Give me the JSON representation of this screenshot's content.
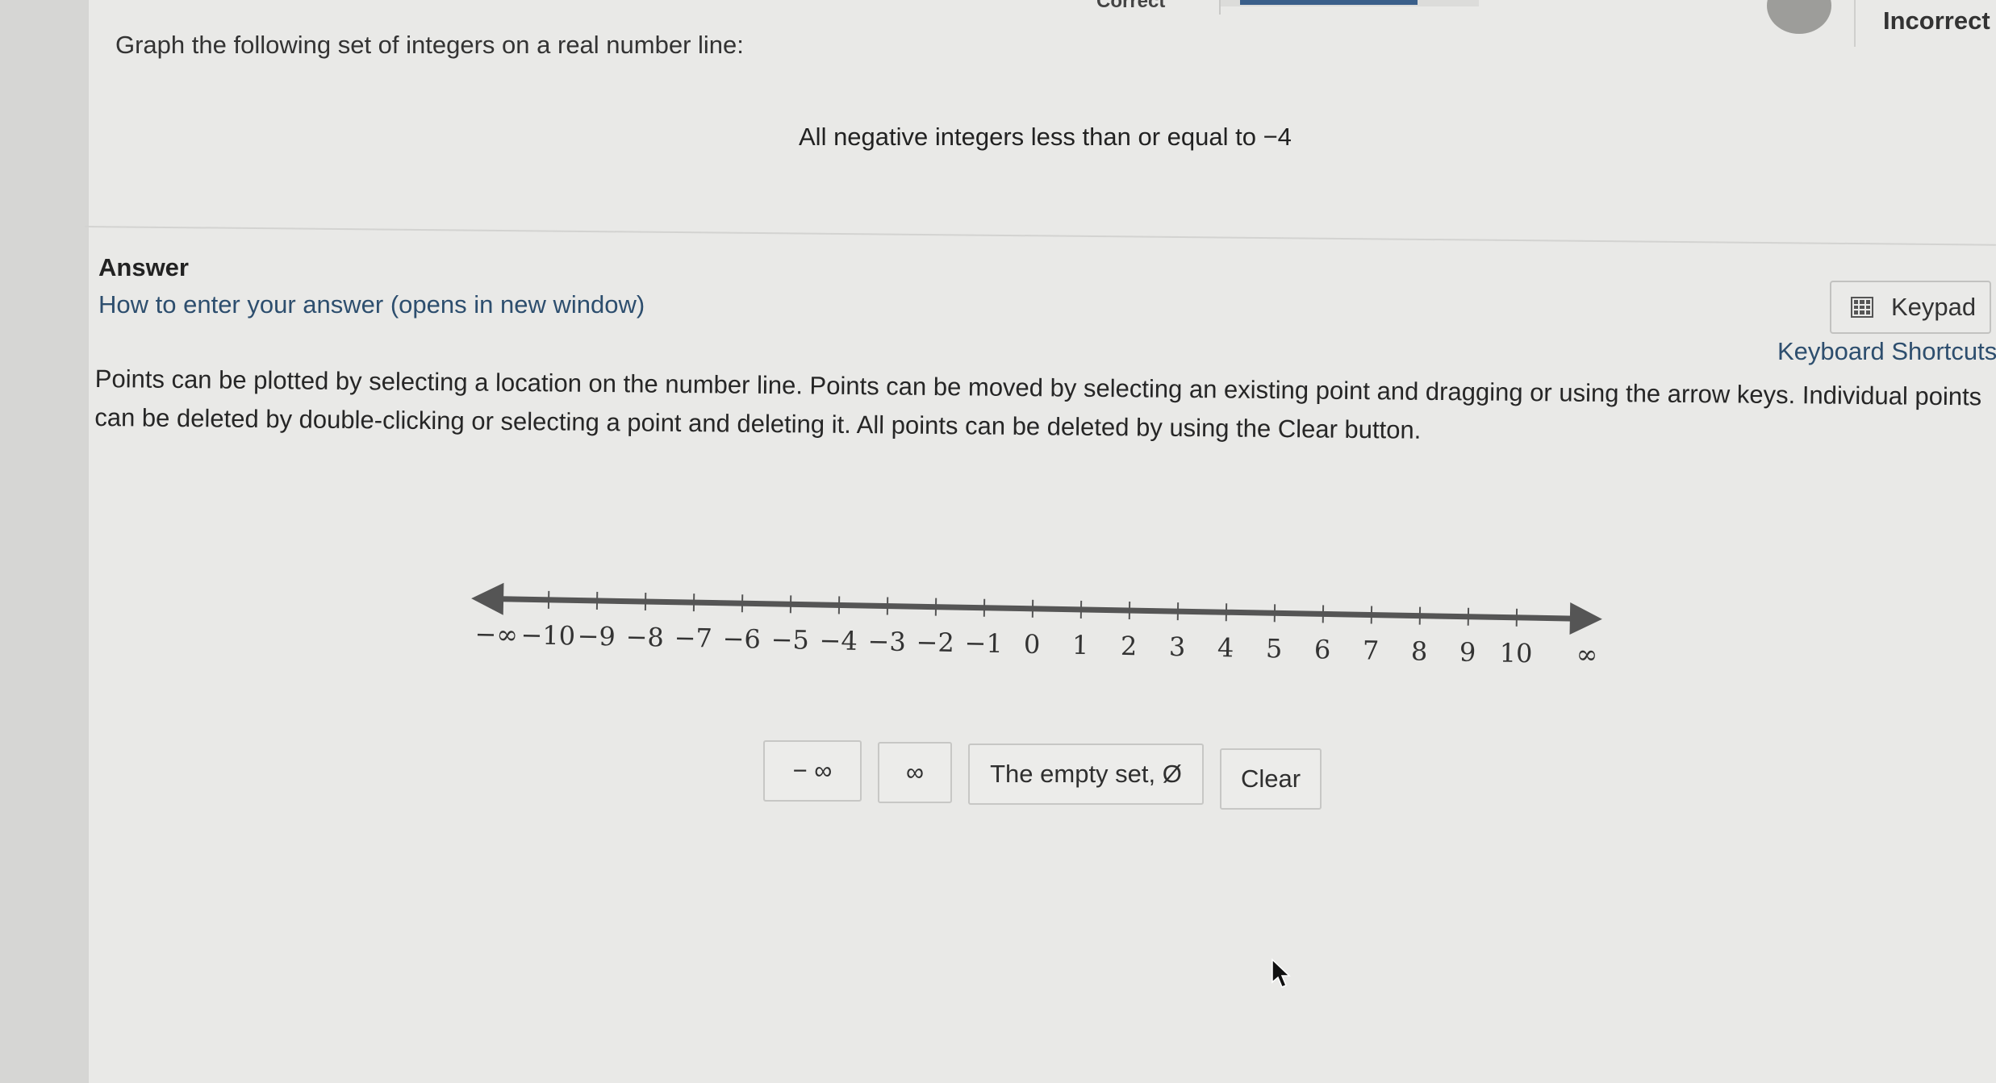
{
  "header": {
    "correct_tab_label": "Correct",
    "status_label": "Incorrect"
  },
  "question": {
    "prompt": "Graph the following set of integers on a real number line:",
    "statement": "All negative integers less than or equal to −4"
  },
  "answer": {
    "title": "Answer",
    "howto_link": "How to enter your answer (opens in new window)",
    "keypad_label": "Keypad",
    "keypad_icon": "calculator-icon",
    "shortcuts_link": "Keyboard Shortcuts",
    "instructions": "Points can be plotted by selecting a location on the number line. Points can be moved by selecting an existing point and dragging or using the arrow keys. Individual points can be deleted by double-clicking or selecting a point and deleting it. All points can be deleted by using the Clear button."
  },
  "number_line": {
    "neg_inf_label": "−∞",
    "pos_inf_label": "∞",
    "tick_labels": [
      "−10",
      "−9",
      "−8",
      "−7",
      "−6",
      "−5",
      "−4",
      "−3",
      "−2",
      "−1",
      "0",
      "1",
      "2",
      "3",
      "4",
      "5",
      "6",
      "7",
      "8",
      "9",
      "10"
    ],
    "line_color": "#555555"
  },
  "buttons": {
    "neg_inf": "− ∞",
    "pos_inf": "∞",
    "empty_set": "The empty set, Ø",
    "clear": "Clear"
  }
}
